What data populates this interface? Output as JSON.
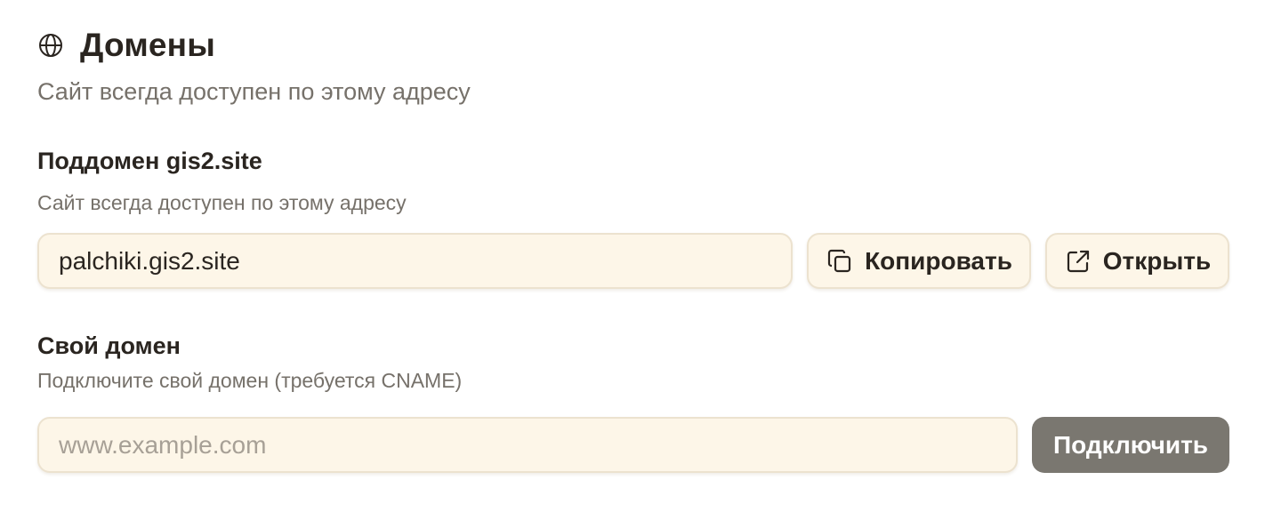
{
  "domains": {
    "title": "Домены",
    "subtitle": "Сайт всегда доступен по этому адресу",
    "icon": "globe-icon"
  },
  "subdomain": {
    "title": "Поддомен gis2.site",
    "hint": "Сайт всегда доступен по этому адресу",
    "value": "palchiki.gis2.site",
    "copy_label": "Копировать",
    "copy_icon": "copy-icon",
    "open_label": "Открыть",
    "open_icon": "external-link-icon"
  },
  "custom_domain": {
    "title": "Свой домен",
    "hint": "Подключите свой домен (требуется CNAME)",
    "placeholder": "www.example.com",
    "value": "",
    "connect_label": "Подключить"
  },
  "colors": {
    "input_background": "#fdf6e8",
    "input_border": "#ece2cf",
    "muted_text": "#76716a",
    "connect_button": "#7a7770"
  }
}
